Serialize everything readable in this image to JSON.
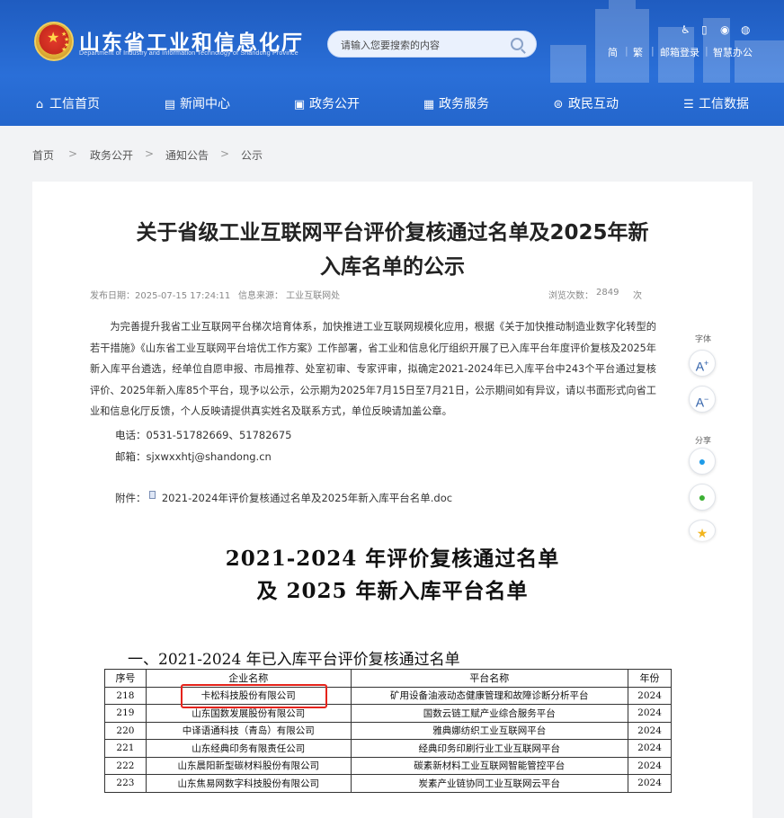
{
  "header": {
    "site_title": "山东省工业和信息化厅",
    "site_subtitle": "Department of Industry and Information Technology of Shandong Province",
    "search_placeholder": "请输入您要搜索的内容",
    "top_icons": [
      "accessibility-icon",
      "mobile-icon",
      "wechat-icon",
      "weibo-icon"
    ],
    "top_links": {
      "simplified": "简",
      "traditional": "繁",
      "sep": "|",
      "mail_login": "邮箱登录",
      "smart_office": "智慧办公"
    },
    "nav": [
      {
        "label": "工信首页",
        "icon": "home-icon"
      },
      {
        "label": "新闻中心",
        "icon": "news-icon"
      },
      {
        "label": "政务公开",
        "icon": "screen-icon"
      },
      {
        "label": "政务服务",
        "icon": "service-icon"
      },
      {
        "label": "政民互动",
        "icon": "interaction-icon"
      },
      {
        "label": "工信数据",
        "icon": "database-icon"
      }
    ]
  },
  "breadcrumb": {
    "items": [
      "首页",
      "政务公开",
      "通知公告",
      "公示"
    ],
    "separator": ">"
  },
  "article": {
    "title_line1": "关于省级工业互联网平台评价复核通过名单及2025年新",
    "title_line2": "入库名单的公示",
    "publish_date": "发布日期：2025-07-15 17:24:11",
    "source": "信息来源： 工业互联网处",
    "views_label": "浏览次数：",
    "views_count": "2849",
    "views_unit": "次",
    "body": "为完善提升我省工业互联网平台梯次培育体系，加快推进工业互联网规模化应用，根据《关于加快推动制造业数字化转型的若干措施》《山东省工业互联网平台培优工作方案》工作部署，省工业和信息化厅组织开展了已入库平台年度评价复核及2025年新入库平台遴选，经单位自愿申报、市局推荐、处室初审、专家评审，拟确定2021-2024年已入库平台中243个平台通过复核评价、2025年新入库85个平台，现予以公示，公示期为2025年7月15日至7月21日，公示期间如有异议，请以书面形式向省工业和信息化厅反馈，个人反映请提供真实姓名及联系方式，单位反映请加盖公章。",
    "phone": "电话：0531-51782669、51782675",
    "email": "邮箱：sjxwxxhtj@shandong.cn",
    "attachment_label": "附件：",
    "attachment_name": "2021-2024年评价复核通过名单及2025年新入库平台名单.doc"
  },
  "side_tools": {
    "font_label": "字体",
    "font_increase": "A",
    "font_decrease": "A",
    "share_label": "分享",
    "share_icons": [
      "qq-icon",
      "wechat-share-icon",
      "qzone-icon"
    ]
  },
  "document": {
    "title_line1": "2021-2024 年评价复核通过名单",
    "title_line2": "及 2025 年新入库平台名单",
    "section_heading": "一、2021-2024 年已入库平台评价复核通过名单",
    "columns": [
      "序号",
      "企业名称",
      "平台名称",
      "年份"
    ],
    "rows": [
      [
        "218",
        "卡松科技股份有限公司",
        "矿用设备油液动态健康管理和故障诊断分析平台",
        "2024"
      ],
      [
        "219",
        "山东国数发展股份有限公司",
        "国数云链工赋产业综合服务平台",
        "2024"
      ],
      [
        "220",
        "中译语通科技（青岛）有限公司",
        "雅典娜纺织工业互联网平台",
        "2024"
      ],
      [
        "221",
        "山东经典印务有限责任公司",
        "经典印务印刷行业工业互联网平台",
        "2024"
      ],
      [
        "222",
        "山东晨阳新型碳材料股份有限公司",
        "碳素新材料工业互联网智能管控平台",
        "2024"
      ],
      [
        "223",
        "山东焦易网数字科技股份有限公司",
        "炭素产业链协同工业互联网云平台",
        "2024"
      ]
    ],
    "highlight_color": "#e5231b"
  },
  "colors": {
    "header_blue": "#2466cc",
    "page_bg": "#f2f3f5",
    "accent_blue": "#2e5fa8"
  }
}
